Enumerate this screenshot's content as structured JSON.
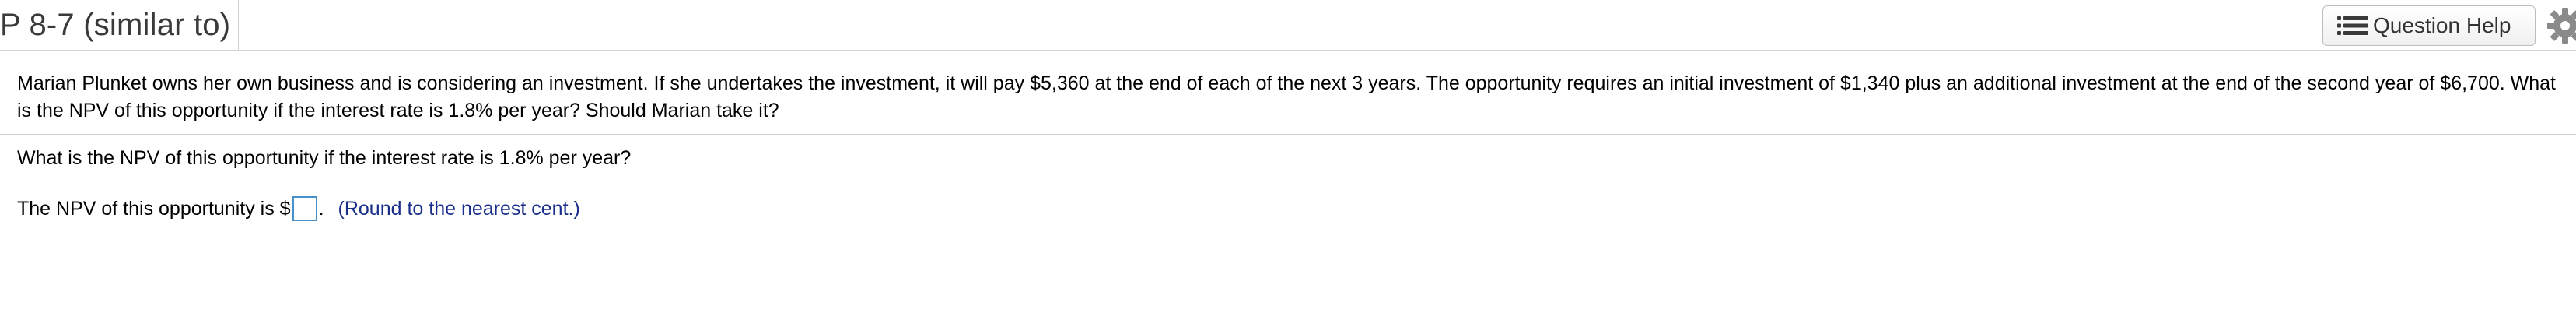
{
  "header": {
    "title": "P 8-7 (similar to)",
    "help_button_label": "Question Help",
    "help_icon": "list-icon",
    "settings_icon": "gear-icon"
  },
  "question": {
    "text": "Marian Plunket owns her own business and is considering an investment. If she undertakes the investment, it will pay $5,360 at the end of each of the next 3 years. The opportunity requires an initial investment of $1,340 plus an additional investment at the end of the second year of $6,700. What is the NPV of this opportunity if the interest rate is 1.8% per year? Should Marian take it?"
  },
  "part": {
    "prompt": "What is the NPV of this opportunity if the interest rate is 1.8% per year?",
    "answer_prefix": "The NPV of this opportunity is $",
    "answer_value": "",
    "answer_suffix": ".",
    "hint": "(Round to the nearest cent.)"
  },
  "colors": {
    "hint_text": "#1a2f8c",
    "input_border": "#4a90c8",
    "divider": "#cfcfcf"
  }
}
